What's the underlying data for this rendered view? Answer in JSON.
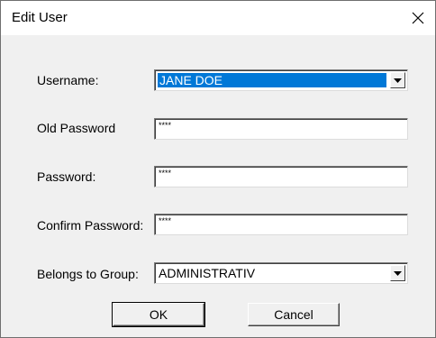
{
  "window": {
    "title": "Edit User",
    "close_icon": "close-icon"
  },
  "form": {
    "username": {
      "label": "Username:",
      "value": "JANE DOE"
    },
    "old_password": {
      "label": "Old Password",
      "value": "****"
    },
    "password": {
      "label": "Password:",
      "value": "****"
    },
    "confirm_password": {
      "label": "Confirm Password:",
      "value": "****"
    },
    "group": {
      "label": "Belongs to Group:",
      "value": "ADMINISTRATIV"
    }
  },
  "buttons": {
    "ok": "OK",
    "cancel": "Cancel"
  },
  "colors": {
    "selection": "#0078d7",
    "dialog_bg": "#f0f0f0"
  }
}
